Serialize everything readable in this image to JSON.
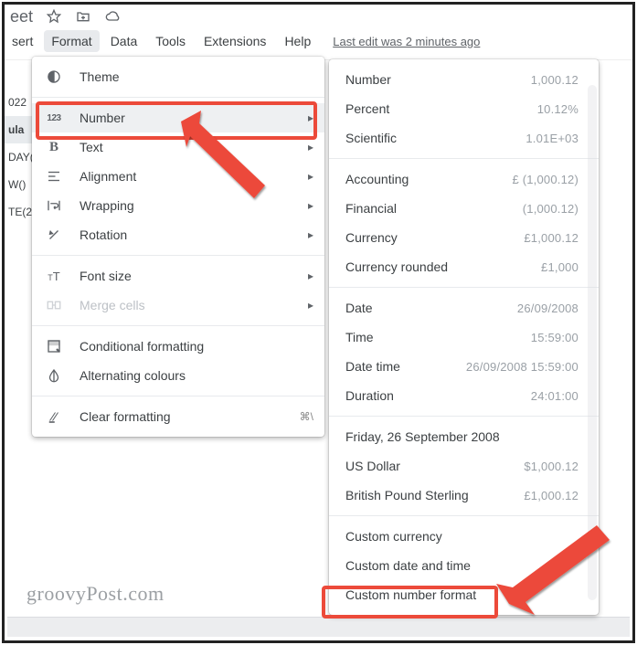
{
  "title": "eet",
  "menubar": {
    "items": [
      "sert",
      "Format",
      "Data",
      "Tools",
      "Extensions",
      "Help"
    ],
    "active_index": 1
  },
  "last_edit": "Last edit was 2 minutes ago",
  "sheet_rows": [
    "022",
    "ula",
    "DAY(",
    "W()",
    "TE(20"
  ],
  "format_menu": {
    "items": [
      {
        "icon": "theme",
        "label": "Theme"
      },
      {
        "sep": true
      },
      {
        "icon": "123",
        "label": "Number",
        "arrow": true,
        "hover": true
      },
      {
        "icon": "B",
        "label": "Text",
        "arrow": true
      },
      {
        "icon": "align",
        "label": "Alignment",
        "arrow": true
      },
      {
        "icon": "wrap",
        "label": "Wrapping",
        "arrow": true
      },
      {
        "icon": "rotate",
        "label": "Rotation",
        "arrow": true
      },
      {
        "sep": true
      },
      {
        "icon": "tT",
        "label": "Font size",
        "arrow": true
      },
      {
        "icon": "merge",
        "label": "Merge cells",
        "arrow": true,
        "disabled": true
      },
      {
        "sep": true
      },
      {
        "icon": "condfmt",
        "label": "Conditional formatting"
      },
      {
        "icon": "altcolor",
        "label": "Alternating colours"
      },
      {
        "sep": true
      },
      {
        "icon": "clear",
        "label": "Clear formatting",
        "shortcut": "⌘\\"
      }
    ]
  },
  "number_submenu": {
    "groups": [
      [
        {
          "label": "Number",
          "value": "1,000.12"
        },
        {
          "label": "Percent",
          "value": "10.12%"
        },
        {
          "label": "Scientific",
          "value": "1.01E+03"
        }
      ],
      [
        {
          "label": "Accounting",
          "value": "£ (1,000.12)"
        },
        {
          "label": "Financial",
          "value": "(1,000.12)"
        },
        {
          "label": "Currency",
          "value": "£1,000.12"
        },
        {
          "label": "Currency rounded",
          "value": "£1,000"
        }
      ],
      [
        {
          "label": "Date",
          "value": "26/09/2008"
        },
        {
          "label": "Time",
          "value": "15:59:00"
        },
        {
          "label": "Date time",
          "value": "26/09/2008 15:59:00"
        },
        {
          "label": "Duration",
          "value": "24:01:00"
        }
      ],
      [
        {
          "label": "Friday, 26 September 2008",
          "value": ""
        },
        {
          "label": "US Dollar",
          "value": "$1,000.12"
        },
        {
          "label": "British Pound Sterling",
          "value": "£1,000.12"
        }
      ],
      [
        {
          "label": "Custom currency",
          "value": ""
        },
        {
          "label": "Custom date and time",
          "value": ""
        },
        {
          "label": "Custom number format",
          "value": ""
        }
      ]
    ]
  },
  "watermark": "groovyPost.com"
}
